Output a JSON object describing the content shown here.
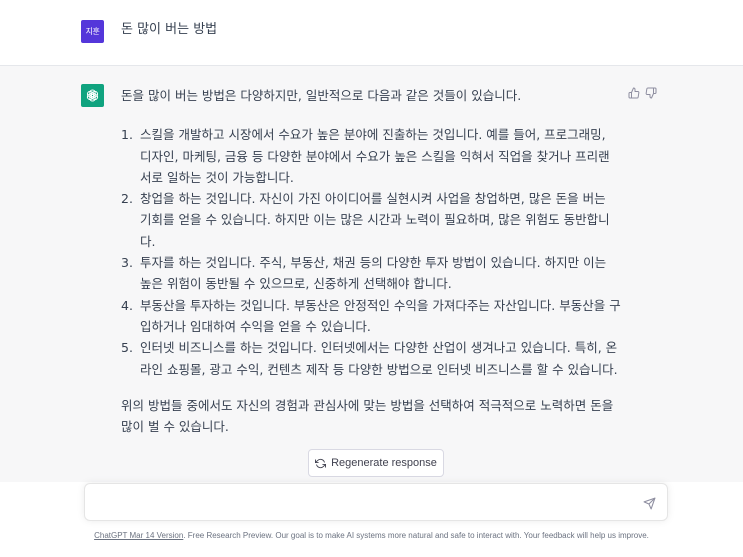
{
  "user": {
    "avatar_text": "지훈",
    "message": "돈 많이 버는 방법"
  },
  "assistant": {
    "intro": "돈을 많이 버는 방법은 다양하지만, 일반적으로 다음과 같은 것들이 있습니다.",
    "items": [
      {
        "num": "1.",
        "text": "스킬을 개발하고 시장에서 수요가 높은 분야에 진출하는 것입니다. 예를 들어, 프로그래밍, 디자인, 마케팅, 금융 등 다양한 분야에서 수요가 높은 스킬을 익혀서 직업을 찾거나 프리랜서로 일하는 것이 가능합니다."
      },
      {
        "num": "2.",
        "text": "창업을 하는 것입니다. 자신이 가진 아이디어를 실현시켜 사업을 창업하면, 많은 돈을 버는 기회를 얻을 수 있습니다. 하지만 이는 많은 시간과 노력이 필요하며, 많은 위험도 동반합니다."
      },
      {
        "num": "3.",
        "text": "투자를 하는 것입니다. 주식, 부동산, 채권 등의 다양한 투자 방법이 있습니다. 하지만 이는 높은 위험이 동반될 수 있으므로, 신중하게 선택해야 합니다."
      },
      {
        "num": "4.",
        "text": "부동산을 투자하는 것입니다. 부동산은 안정적인 수익을 가져다주는 자산입니다. 부동산을 구입하거나 임대하여 수익을 얻을 수 있습니다."
      },
      {
        "num": "5.",
        "text": "인터넷 비즈니스를 하는 것입니다. 인터넷에서는 다양한 산업이 생겨나고 있습니다. 특히, 온라인 쇼핑몰, 광고 수익, 컨텐츠 제작 등 다양한 방법으로 인터넷 비즈니스를 할 수 있습니다."
      }
    ],
    "closing": "위의 방법들 중에서도 자신의 경험과 관심사에 맞는 방법을 선택하여 적극적으로 노력하면 돈을 많이 벌 수 있습니다."
  },
  "regenerate_label": "Regenerate response",
  "input": {
    "value": ""
  },
  "footer": {
    "version_link": "ChatGPT Mar 14 Version",
    "text": ". Free Research Preview. Our goal is to make AI systems more natural and safe to interact with. Your feedback will help us improve."
  },
  "colors": {
    "user_avatar": "#5436da",
    "gpt_logo": "#10a37f",
    "assistant_bg": "#f7f7f8"
  }
}
